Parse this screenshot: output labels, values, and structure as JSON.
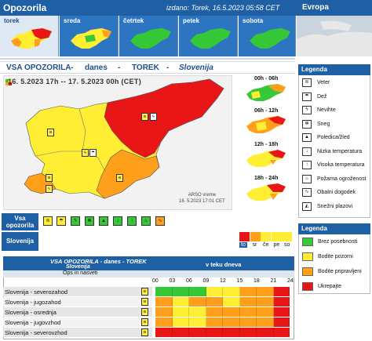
{
  "header": {
    "title": "Opozorila",
    "issued": "izdano: Torek, 16.5.2023 05:58 CET",
    "europe": "Evropa"
  },
  "days": [
    {
      "name": "torek",
      "selected": true
    },
    {
      "name": "sreda",
      "selected": false
    },
    {
      "name": "četrtek",
      "selected": false
    },
    {
      "name": "petek",
      "selected": false
    },
    {
      "name": "sobota",
      "selected": false
    }
  ],
  "band": {
    "p1": "VSA OPOZORILA",
    "p2": "danes",
    "p3": "TOREK",
    "p4": "Slovenija"
  },
  "map": {
    "title": "16. 5.2023 17h  --  17. 5.2023 00h   (CET)",
    "credit1": "ARSO vreme",
    "credit2": "16. 5.2023   17:01 CET"
  },
  "mini": [
    "00h - 06h",
    "06h - 12h",
    "12h - 18h",
    "18h - 24h"
  ],
  "legend": {
    "title": "Legenda",
    "items": [
      {
        "label": "Veter",
        "icon": "wind-icon",
        "sym": "≋"
      },
      {
        "label": "Dež",
        "icon": "rain-icon",
        "sym": "☂"
      },
      {
        "label": "Nevihte",
        "icon": "thunder-icon",
        "sym": "ϟ"
      },
      {
        "label": "Sneg",
        "icon": "snow-icon",
        "sym": "✻"
      },
      {
        "label": "Poledica/žled",
        "icon": "ice-icon",
        "sym": "▲"
      },
      {
        "label": "Nizka temperatura",
        "icon": "low-temp-icon",
        "sym": "↓"
      },
      {
        "label": "Visoka temperatura",
        "icon": "high-temp-icon",
        "sym": "↑"
      },
      {
        "label": "Požarna ogroženost",
        "icon": "fire-icon",
        "sym": "♨"
      },
      {
        "label": "Obalni dogodek",
        "icon": "coastal-icon",
        "sym": "∿"
      },
      {
        "label": "Snežni plazovi",
        "icon": "avalanche-icon",
        "sym": "◭"
      }
    ]
  },
  "color_legend": {
    "title": "Legenda",
    "items": [
      {
        "label": "Brez posebnosti",
        "color": "#37c837"
      },
      {
        "label": "Bodite pozorni",
        "color": "#ffee33"
      },
      {
        "label": "Bodite pripravljeni",
        "color": "#ff9f1a"
      },
      {
        "label": "Ukrepajte",
        "color": "#e81616"
      }
    ]
  },
  "strip": {
    "vsa": "Vsa opozorila",
    "slovenija": "Slovenija",
    "timeline": [
      "to",
      "sr",
      "če",
      "pe",
      "so"
    ],
    "timeline_colors": [
      "#e81616",
      "#ff9f1a",
      "#ffee33",
      "#ffee33",
      "#ffee33"
    ]
  },
  "table": {
    "title": "VSA OPOZORILA - danes - TOREK",
    "region": "Slovenija",
    "col_head": "Ops in nasveti",
    "time_head": "v teku dneva",
    "hours": [
      "00",
      "03",
      "06",
      "09",
      "12",
      "15",
      "18",
      "21",
      "24"
    ],
    "rows": [
      {
        "label": "Slovenija - severozahod",
        "cells": [
          "#37c837",
          "#37c837",
          "#37c837",
          "#ffee33",
          "#ffee33",
          "#ff9f1a",
          "#ff9f1a",
          "#e81616"
        ]
      },
      {
        "label": "Slovenija - jugozahod",
        "cells": [
          "#ff9f1a",
          "#ffee33",
          "#ff9f1a",
          "#ff9f1a",
          "#ffee33",
          "#ff9f1a",
          "#ff9f1a",
          "#e81616"
        ]
      },
      {
        "label": "Slovenija - osrednja",
        "cells": [
          "#ff9f1a",
          "#ffee33",
          "#ffee33",
          "#ff9f1a",
          "#ff9f1a",
          "#ff9f1a",
          "#ff9f1a",
          "#e81616"
        ]
      },
      {
        "label": "Slovenija - jugovzhod",
        "cells": [
          "#ff9f1a",
          "#ffee33",
          "#ffee33",
          "#ff9f1a",
          "#ff9f1a",
          "#ff9f1a",
          "#ff9f1a",
          "#e81616"
        ]
      },
      {
        "label": "Slovenija - severovzhod",
        "cells": [
          "#e81616",
          "#e81616",
          "#e81616",
          "#e81616",
          "#e81616",
          "#e81616",
          "#e81616",
          "#e81616"
        ]
      }
    ]
  }
}
